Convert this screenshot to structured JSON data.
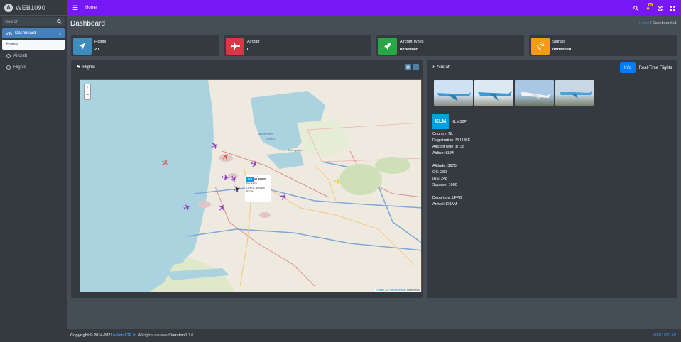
{
  "brand": {
    "name": "WEB1090",
    "logo_letter": "A"
  },
  "search": {
    "placeholder": "Search"
  },
  "sidebar": {
    "items": [
      {
        "label": "Dashboard"
      },
      {
        "label": "Home"
      },
      {
        "label": "Aircraft"
      },
      {
        "label": "Flights"
      }
    ]
  },
  "navbar": {
    "home_label": "Home",
    "notification_count": "15"
  },
  "page": {
    "title": "Dashboard",
    "breadcrumb_home": "Home",
    "breadcrumb_sep": "/",
    "breadcrumb_current": "Dashboard v1"
  },
  "stats": [
    {
      "label": "Flights",
      "value": "20",
      "color": "#3c8dbc",
      "icon": "paper-plane-icon"
    },
    {
      "label": "Aircraft",
      "value": "0",
      "color": "#dc3545",
      "icon": "plane-icon"
    },
    {
      "label": "Aircraft Types",
      "value": "undefined",
      "color": "#28a745",
      "icon": "rocket-icon"
    },
    {
      "label": "Signals",
      "value": "undefined",
      "color": "#f39c12",
      "icon": "satellite-dish-icon"
    }
  ],
  "flights_card": {
    "title": "Flights"
  },
  "map": {
    "popup_callsign": "KLM38P",
    "popup_reg": "PH-HSE",
    "popup_route": "LFPG - EHAM",
    "popup_type": "B738",
    "popup_logo": "KLM",
    "attribution_leaflet": "Leaflet",
    "attribution_sep": " | © ",
    "attribution_osm": "OpenStreetMap",
    "attribution_tail": " contributors",
    "zoom_in": "+",
    "zoom_out": "−",
    "labels": {
      "markermeer": "Markermeer",
      "ijmeer": "IJmeer",
      "flevopolder": "Flevopolder"
    }
  },
  "aircraft_card": {
    "title": "Aircraft",
    "tab_info": "Info",
    "tab_realtime": "Real-Time Flights",
    "logo": "KLM",
    "callsign": "KLM38P",
    "country": "Country: NL",
    "registration": "Registration: PH-HSE",
    "type": "Aircraft type: B738",
    "airline": "Airline: KLM",
    "altitude": "Altitude: 3675",
    "gs": "GS: 280",
    "ias": "IAS: 248",
    "squawk": "Squawk: 1000",
    "departure": "Departure: LFPG",
    "arrival": "Arrival: EHAM"
  },
  "footer": {
    "copyright": "Copyright © 2014-2021 ",
    "link": "AdminLTE.io",
    "rights": ". All rights reserved. ",
    "version_label": "Version",
    "version_value": " 3.1.0",
    "api": "WEB1090 API"
  },
  "colors": {
    "navbar": "#7618f5",
    "accent": "#3f8ddb",
    "selected_plane": "#ffd21f",
    "plane": "#8a35c9",
    "alert_plane": "#e0544f"
  }
}
